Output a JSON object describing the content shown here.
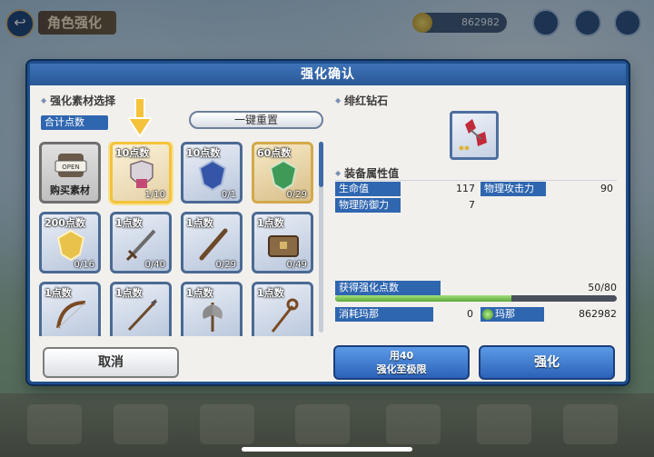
{
  "header": {
    "title": "角色强化",
    "coins": "862982"
  },
  "dialog": {
    "title": "强化确认",
    "left": {
      "section_title": "强化素材选择",
      "total_label": "合计点数",
      "reset_label": "一键重置",
      "tiles": [
        {
          "type": "shop",
          "shop_text": "OPEN",
          "label": "购买素材"
        },
        {
          "points": "10点数",
          "count": "1/10",
          "icon": "armor-icon",
          "selected": true
        },
        {
          "points": "10点数",
          "count": "0/1",
          "icon": "blue-gem-shield-icon"
        },
        {
          "points": "60点数",
          "count": "0/29",
          "icon": "green-gem-shield-icon"
        },
        {
          "points": "200点数",
          "count": "0/16",
          "icon": "gold-gem-shield-icon"
        },
        {
          "points": "1点数",
          "count": "0/40",
          "icon": "sword-icon"
        },
        {
          "points": "1点数",
          "count": "0/29",
          "icon": "dagger-icon"
        },
        {
          "points": "1点数",
          "count": "0/49",
          "icon": "chest-icon"
        },
        {
          "points": "1点数",
          "count": "",
          "icon": "bow-icon"
        },
        {
          "points": "1点数",
          "count": "",
          "icon": "spear-icon"
        },
        {
          "points": "1点数",
          "count": "",
          "icon": "axe-icon"
        },
        {
          "points": "1点数",
          "count": "",
          "icon": "staff-icon"
        }
      ],
      "cancel_label": "取消"
    },
    "right": {
      "item_section": "绯红钻石",
      "item_icon": "crimson-gem-icon",
      "stats_section": "装备属性值",
      "stats": [
        {
          "label": "生命值",
          "value": "117"
        },
        {
          "label": "物理攻击力",
          "value": "90"
        },
        {
          "label": "物理防御力",
          "value": "7"
        }
      ],
      "points_label": "获得强化点数",
      "points_value": "50/80",
      "points_fraction": 0.625,
      "cost_label": "消耗玛那",
      "cost_value": "0",
      "mana_label": "玛那",
      "mana_value": "862982",
      "max_btn_line1": "用40",
      "max_btn_line2": "强化至极限",
      "enhance_label": "强化"
    }
  }
}
